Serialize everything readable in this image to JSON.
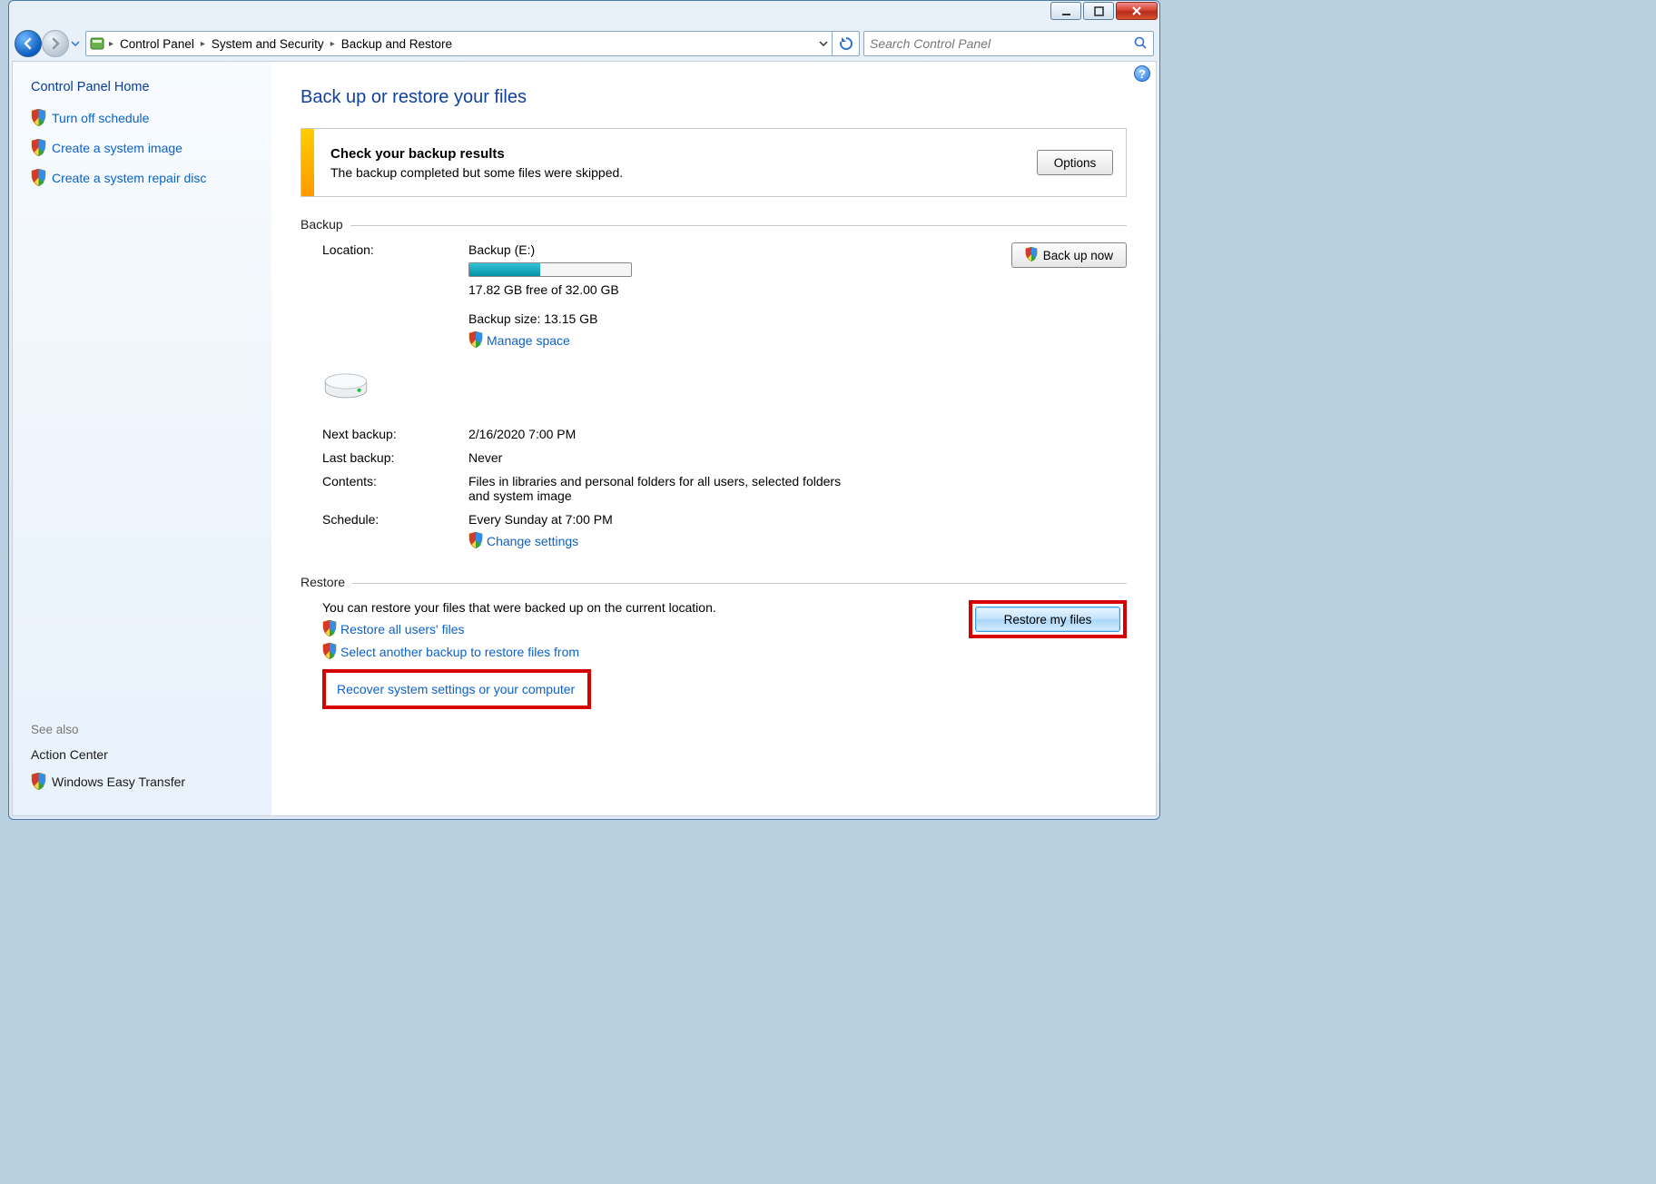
{
  "breadcrumb": {
    "seg1": "Control Panel",
    "seg2": "System and Security",
    "seg3": "Backup and Restore"
  },
  "search": {
    "placeholder": "Search Control Panel"
  },
  "sidebar": {
    "heading": "Control Panel Home",
    "items": [
      {
        "label": "Turn off schedule"
      },
      {
        "label": "Create a system image"
      },
      {
        "label": "Create a system repair disc"
      }
    ],
    "see_also_label": "See also",
    "see_also": [
      {
        "label": "Action Center",
        "icon": false
      },
      {
        "label": "Windows Easy Transfer",
        "icon": true
      }
    ]
  },
  "main": {
    "title": "Back up or restore your files",
    "alert": {
      "heading": "Check your backup results",
      "body": "The backup completed but some files were skipped.",
      "button": "Options"
    },
    "backup": {
      "section_label": "Backup",
      "location_label": "Location:",
      "location_value": "Backup (E:)",
      "free_text": "17.82 GB free of 32.00 GB",
      "backup_size": "Backup size: 13.15 GB",
      "manage_space": "Manage space",
      "backup_now": "Back up now",
      "next_label": "Next backup:",
      "next_value": "2/16/2020 7:00 PM",
      "last_label": "Last backup:",
      "last_value": "Never",
      "contents_label": "Contents:",
      "contents_value": "Files in libraries and personal folders for all users, selected folders and system image",
      "schedule_label": "Schedule:",
      "schedule_value": "Every Sunday at 7:00 PM",
      "change_settings": "Change settings"
    },
    "restore": {
      "section_label": "Restore",
      "desc": "You can restore your files that were backed up on the current location.",
      "restore_all": "Restore all users' files",
      "select_another": "Select another backup to restore files from",
      "recover_link": "Recover system settings or your computer",
      "restore_my_files": "Restore my files"
    }
  }
}
